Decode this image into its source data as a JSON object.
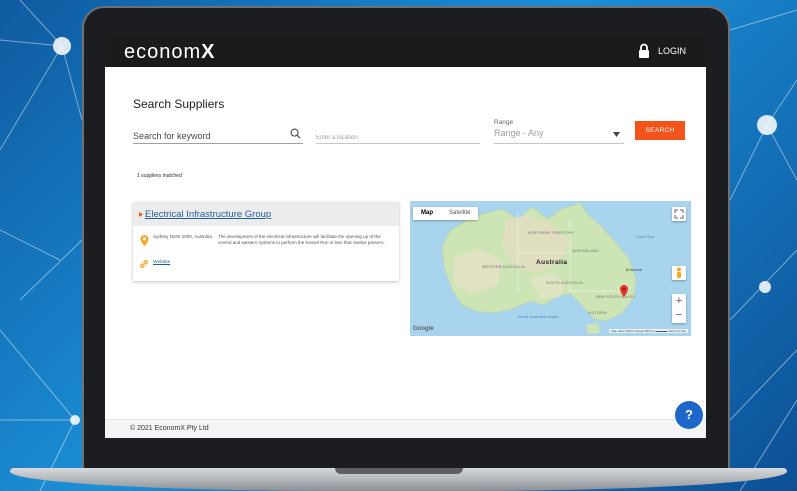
{
  "brand": {
    "logo_main": "econom",
    "logo_x": "X"
  },
  "header": {
    "login_label": "LOGIN"
  },
  "search": {
    "title": "Search Suppliers",
    "keyword_placeholder": "Search for keyword",
    "location_placeholder": "Enter a location",
    "range_label": "Range",
    "range_value": "Range - Any",
    "button_label": "SEARCH"
  },
  "results": {
    "count_text": "1 suppliers matched",
    "items": [
      {
        "name": "Electrical Infrastructure Group",
        "address": "Sydney NSW 2000, Australia",
        "website_label": "Website",
        "description": "The development of the electrical infrastructure will facilitate the opening up of the central and western systems to perform the Kessel Run in less than twelve parsecs."
      }
    ]
  },
  "map": {
    "tabs": [
      "Map",
      "Satellite"
    ],
    "country_label": "Australia",
    "labels": [
      "NORTHERN TERRITORY",
      "QUEENSLAND",
      "WESTERN AUSTRALIA",
      "SOUTH AUSTRALIA",
      "NEW SOUTH WALES",
      "VICTORIA",
      "Brisbane",
      "Coral Sea",
      "Great Australian Bight"
    ],
    "provider": "Google",
    "attribution": "Map data ©2021 Google   500 km ▬▬▬▬   Terms of Use",
    "zoom_in": "+",
    "zoom_out": "−"
  },
  "footer": {
    "copyright": "© 2021 EconomX Pty Ltd"
  },
  "help": {
    "label": "?"
  },
  "colors": {
    "accent": "#f2541b",
    "topbar": "#1b1b1b",
    "link": "#1f5f9e",
    "help": "#1e66c9"
  }
}
